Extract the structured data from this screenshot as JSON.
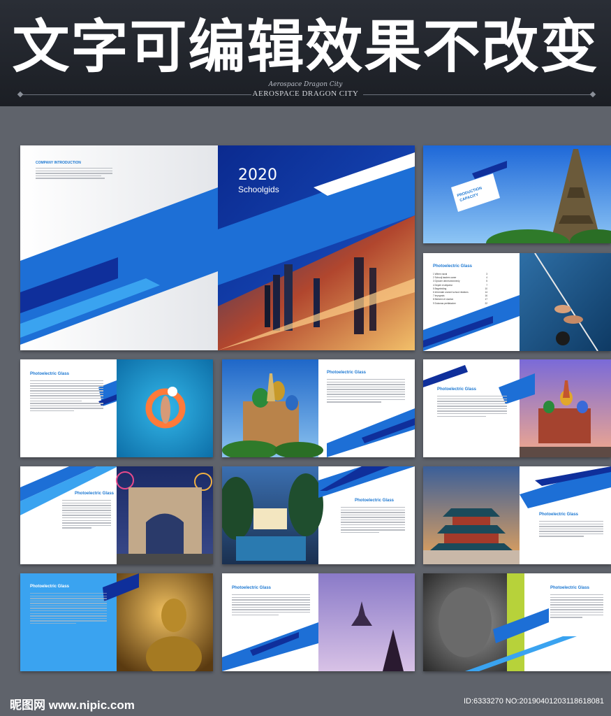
{
  "header": {
    "headline": "文字可编辑效果不改变",
    "script_line": "Aerospace Dragon City",
    "caps_line": "AEROSPACE DRAGON CITY"
  },
  "cover": {
    "year": "2020",
    "title": "Schoolgids",
    "company_intro": "COMPANY INTRODUCTION"
  },
  "production": {
    "label_1": "PRODUCTION",
    "label_2": "CAPACITY"
  },
  "section_title": "Photoelectric Glass",
  "toc": [
    {
      "num": "1",
      "label": "Witem naval",
      "page": "3"
    },
    {
      "num": "2",
      "label": "Schoolj tasdem oaner",
      "page": "4"
    },
    {
      "num": "3",
      "label": "Optuxer denerumnevenly",
      "page": "5"
    },
    {
      "num": "4",
      "label": "Depeh et altportor",
      "page": "7"
    },
    {
      "num": "5",
      "label": "Begeleiding",
      "page": "10"
    },
    {
      "num": "6",
      "label": "Informate oronnel school relations",
      "page": "14"
    },
    {
      "num": "7",
      "label": "Imprgnsis",
      "page": "16"
    },
    {
      "num": "8",
      "label": "Berkeen et duction",
      "page": "17"
    },
    {
      "num": "9",
      "label": "Dukonas pertfalacker",
      "page": "22"
    }
  ],
  "footer": {
    "logo": "昵图网 www.nipic.com",
    "id": "ID:6333270 NO:20190401203118618081"
  },
  "colors": {
    "blue_dark": "#0f2f9b",
    "blue": "#1d6fd6",
    "blue_light": "#3aa3f0"
  }
}
